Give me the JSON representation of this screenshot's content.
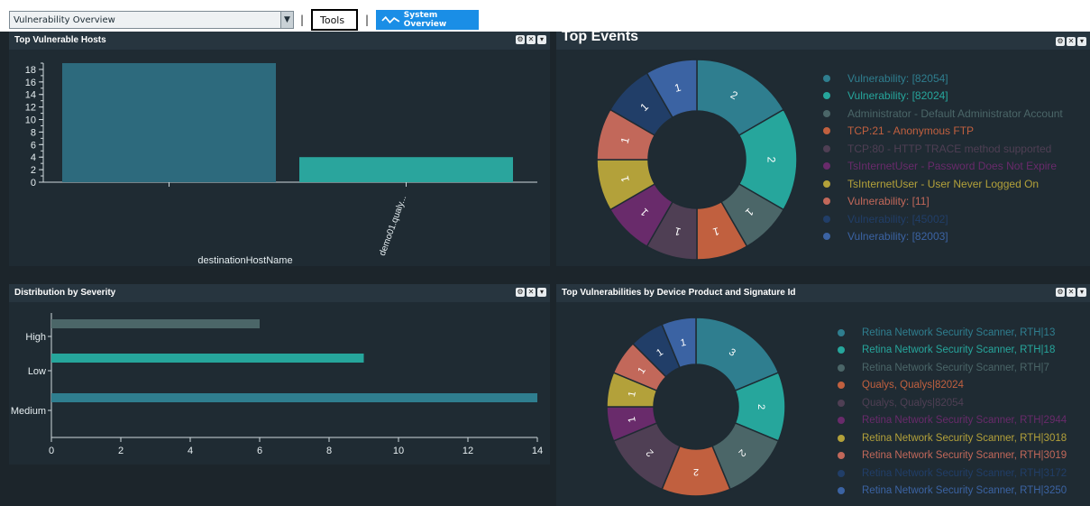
{
  "toolbar": {
    "dashboard_select": "Vulnerability Overview",
    "tools_label": "Tools",
    "system_overview_label": "System Overview",
    "separator": "|"
  },
  "panels": {
    "top_vulnerable_hosts": {
      "title": "Top Vulnerable Hosts",
      "controls": [
        "⚙",
        "✕",
        "▾"
      ]
    },
    "top_events": {
      "title": "Top Events",
      "controls": [
        "⚙",
        "✕",
        "▾"
      ]
    },
    "distribution_by_severity": {
      "title": "Distribution by Severity",
      "controls": [
        "⚙",
        "✕",
        "▾"
      ]
    },
    "top_vulnerabilities": {
      "title": "Top Vulnerabilities by Device Product and Signature Id",
      "controls": [
        "⚙",
        "✕",
        "▾"
      ]
    }
  },
  "chart_data": [
    {
      "type": "bar",
      "title": "Top Vulnerable Hosts",
      "xlabel": "destinationHostName",
      "categories": [
        "",
        "demo01.qualy..."
      ],
      "values": [
        19,
        4
      ],
      "colors": [
        "#2d6a7d",
        "#2aa59d"
      ],
      "ylim": [
        0,
        19
      ],
      "yticks": [
        0,
        2,
        4,
        6,
        8,
        10,
        12,
        14,
        16,
        18
      ]
    },
    {
      "type": "pie",
      "title": "Top Events",
      "labels": [
        "Vulnerability: [82054]",
        "Vulnerability: [82024]",
        "Administrator - Default Administrator Account",
        "TCP:21 - Anonymous FTP",
        "TCP:80 - HTTP TRACE method supported",
        "TsInternetUser - Password Does Not Expire",
        "TsInternetUser - User Never Logged On",
        "Vulnerability: [11]",
        "Vulnerability: [45002]",
        "Vulnerability: [82003]"
      ],
      "values": [
        2,
        2,
        1,
        1,
        1,
        1,
        1,
        1,
        1,
        1
      ],
      "colors": [
        "#2f7e8f",
        "#26a69c",
        "#4b6668",
        "#c1603f",
        "#4f3f54",
        "#692b6b",
        "#b3a13a",
        "#c2685a",
        "#213e68",
        "#3b63a3"
      ]
    },
    {
      "type": "bar",
      "title": "Distribution by Severity",
      "orientation": "horizontal",
      "categories": [
        "High",
        "Low",
        "Medium"
      ],
      "values": [
        6,
        9,
        14
      ],
      "colors": [
        "#4b6668",
        "#26a69c",
        "#2f7e8f"
      ],
      "xlim": [
        0,
        14
      ],
      "xticks": [
        0,
        2,
        4,
        6,
        8,
        10,
        12,
        14
      ]
    },
    {
      "type": "pie",
      "title": "Top Vulnerabilities by Device Product and Signature Id",
      "labels": [
        "Retina Network Security Scanner, RTH|13",
        "Retina Network Security Scanner, RTH|18",
        "Retina Network Security Scanner, RTH|7",
        "Qualys, Qualys|82024",
        "Qualys, Qualys|82054",
        "Retina Network Security Scanner, RTH|2944",
        "Retina Network Security Scanner, RTH|3018",
        "Retina Network Security Scanner, RTH|3019",
        "Retina Network Security Scanner, RTH|3172",
        "Retina Network Security Scanner, RTH|3250"
      ],
      "values": [
        3,
        2,
        2,
        2,
        2,
        1,
        1,
        1,
        1,
        1
      ],
      "colors": [
        "#2f7e8f",
        "#26a69c",
        "#4b6668",
        "#c1603f",
        "#4f3f54",
        "#692b6b",
        "#b3a13a",
        "#c2685a",
        "#213e68",
        "#3b63a3"
      ]
    }
  ]
}
